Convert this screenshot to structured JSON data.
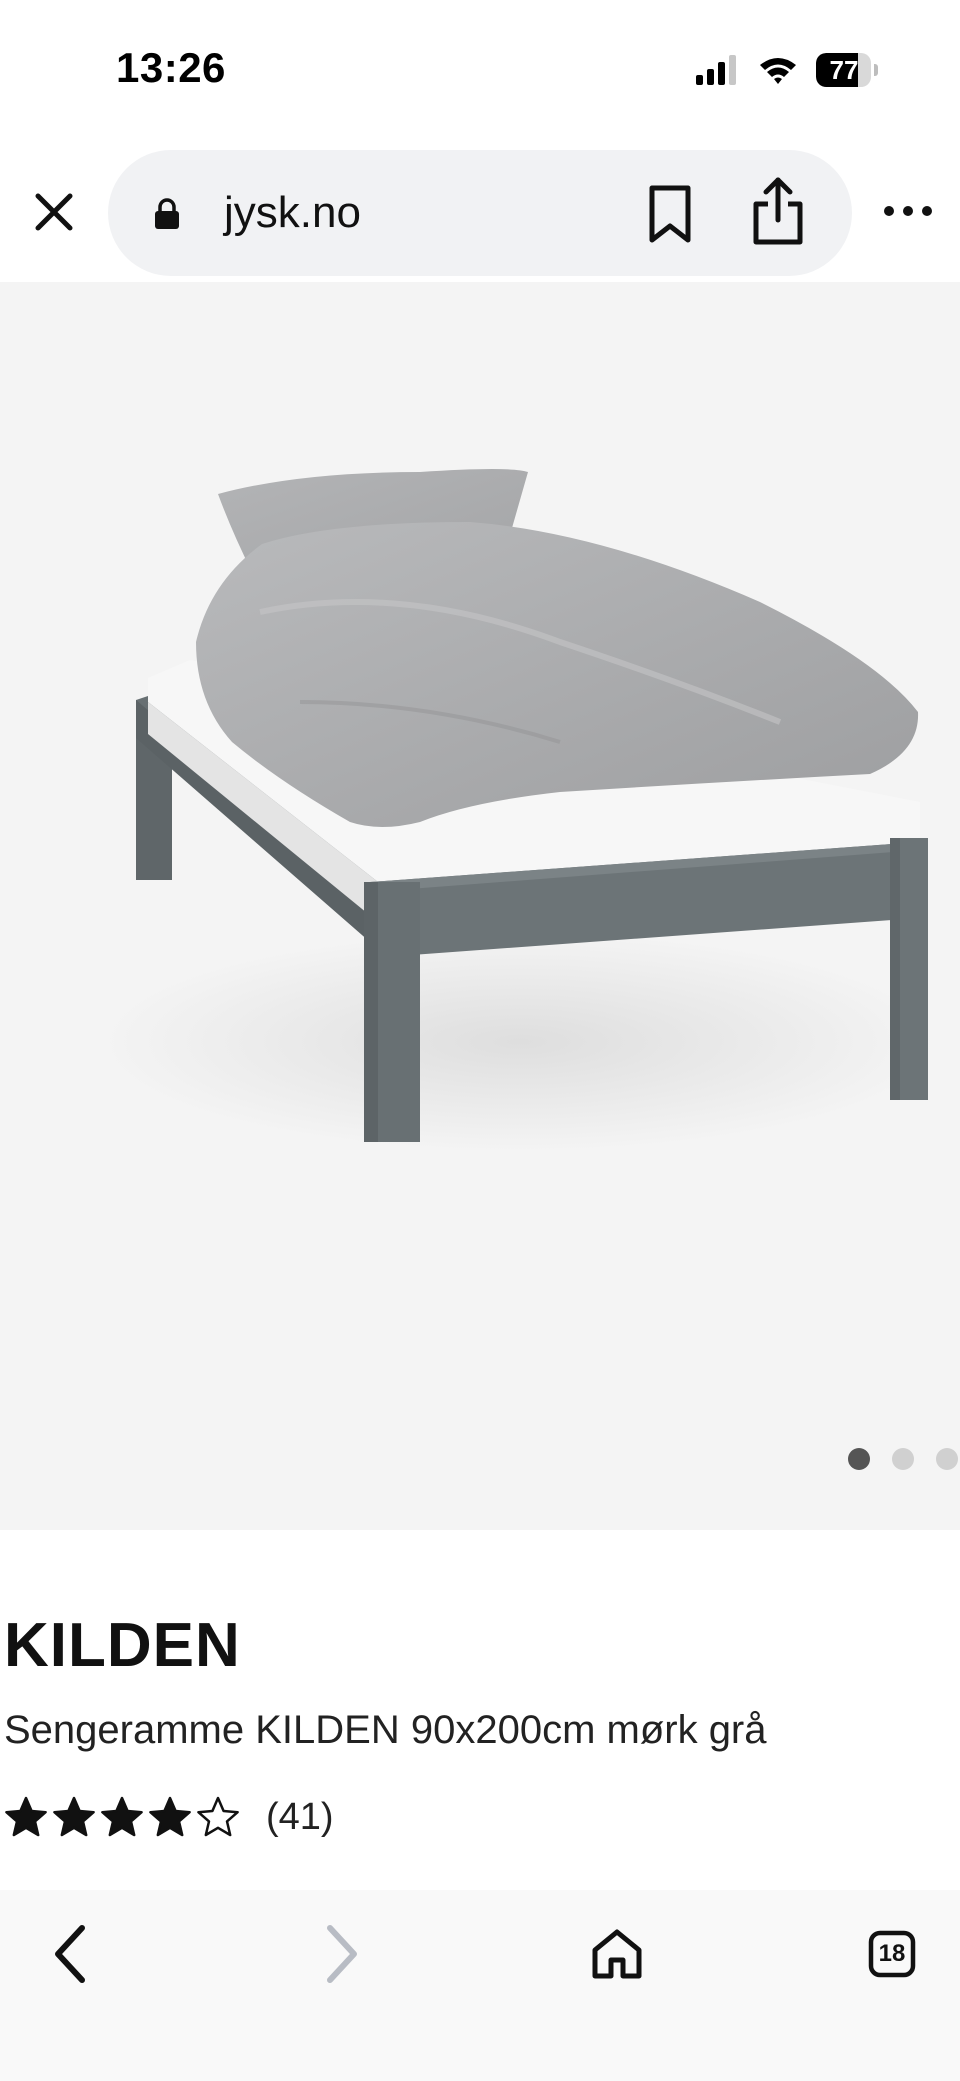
{
  "status_bar": {
    "time": "13:26",
    "battery_level": "77",
    "battery_fraction": 0.77,
    "icons": [
      "cellular-signal-icon",
      "wifi-icon",
      "battery-icon"
    ]
  },
  "browser": {
    "url": "jysk.no",
    "icons": {
      "close": "close-icon",
      "lock": "lock-icon",
      "bookmark": "bookmark-icon",
      "share": "share-icon",
      "more": "more-icon"
    }
  },
  "product": {
    "image_subject": "bed-frame",
    "carousel": {
      "active_index": 0,
      "visible_dots": 3
    },
    "name": "KILDEN",
    "description": "Sengeramme KILDEN 90x200cm mørk grå",
    "rating": {
      "value": 4.5,
      "max": 5,
      "review_count": "(41)"
    }
  },
  "bottom_toolbar": {
    "back_enabled": true,
    "forward_enabled": false,
    "tab_count": "18",
    "icons": [
      "back-arrow-icon",
      "forward-arrow-icon",
      "home-icon",
      "tabs-icon"
    ]
  },
  "colors": {
    "page_bg": "#ffffff",
    "hero_bg": "#f4f4f4",
    "url_pill_bg": "#f1f2f4",
    "text": "#111111",
    "dot_active": "#555555",
    "dot_inactive": "#d0d0d0",
    "forward_disabled": "#b8bcc4",
    "bed_frame": "#6a7174"
  }
}
